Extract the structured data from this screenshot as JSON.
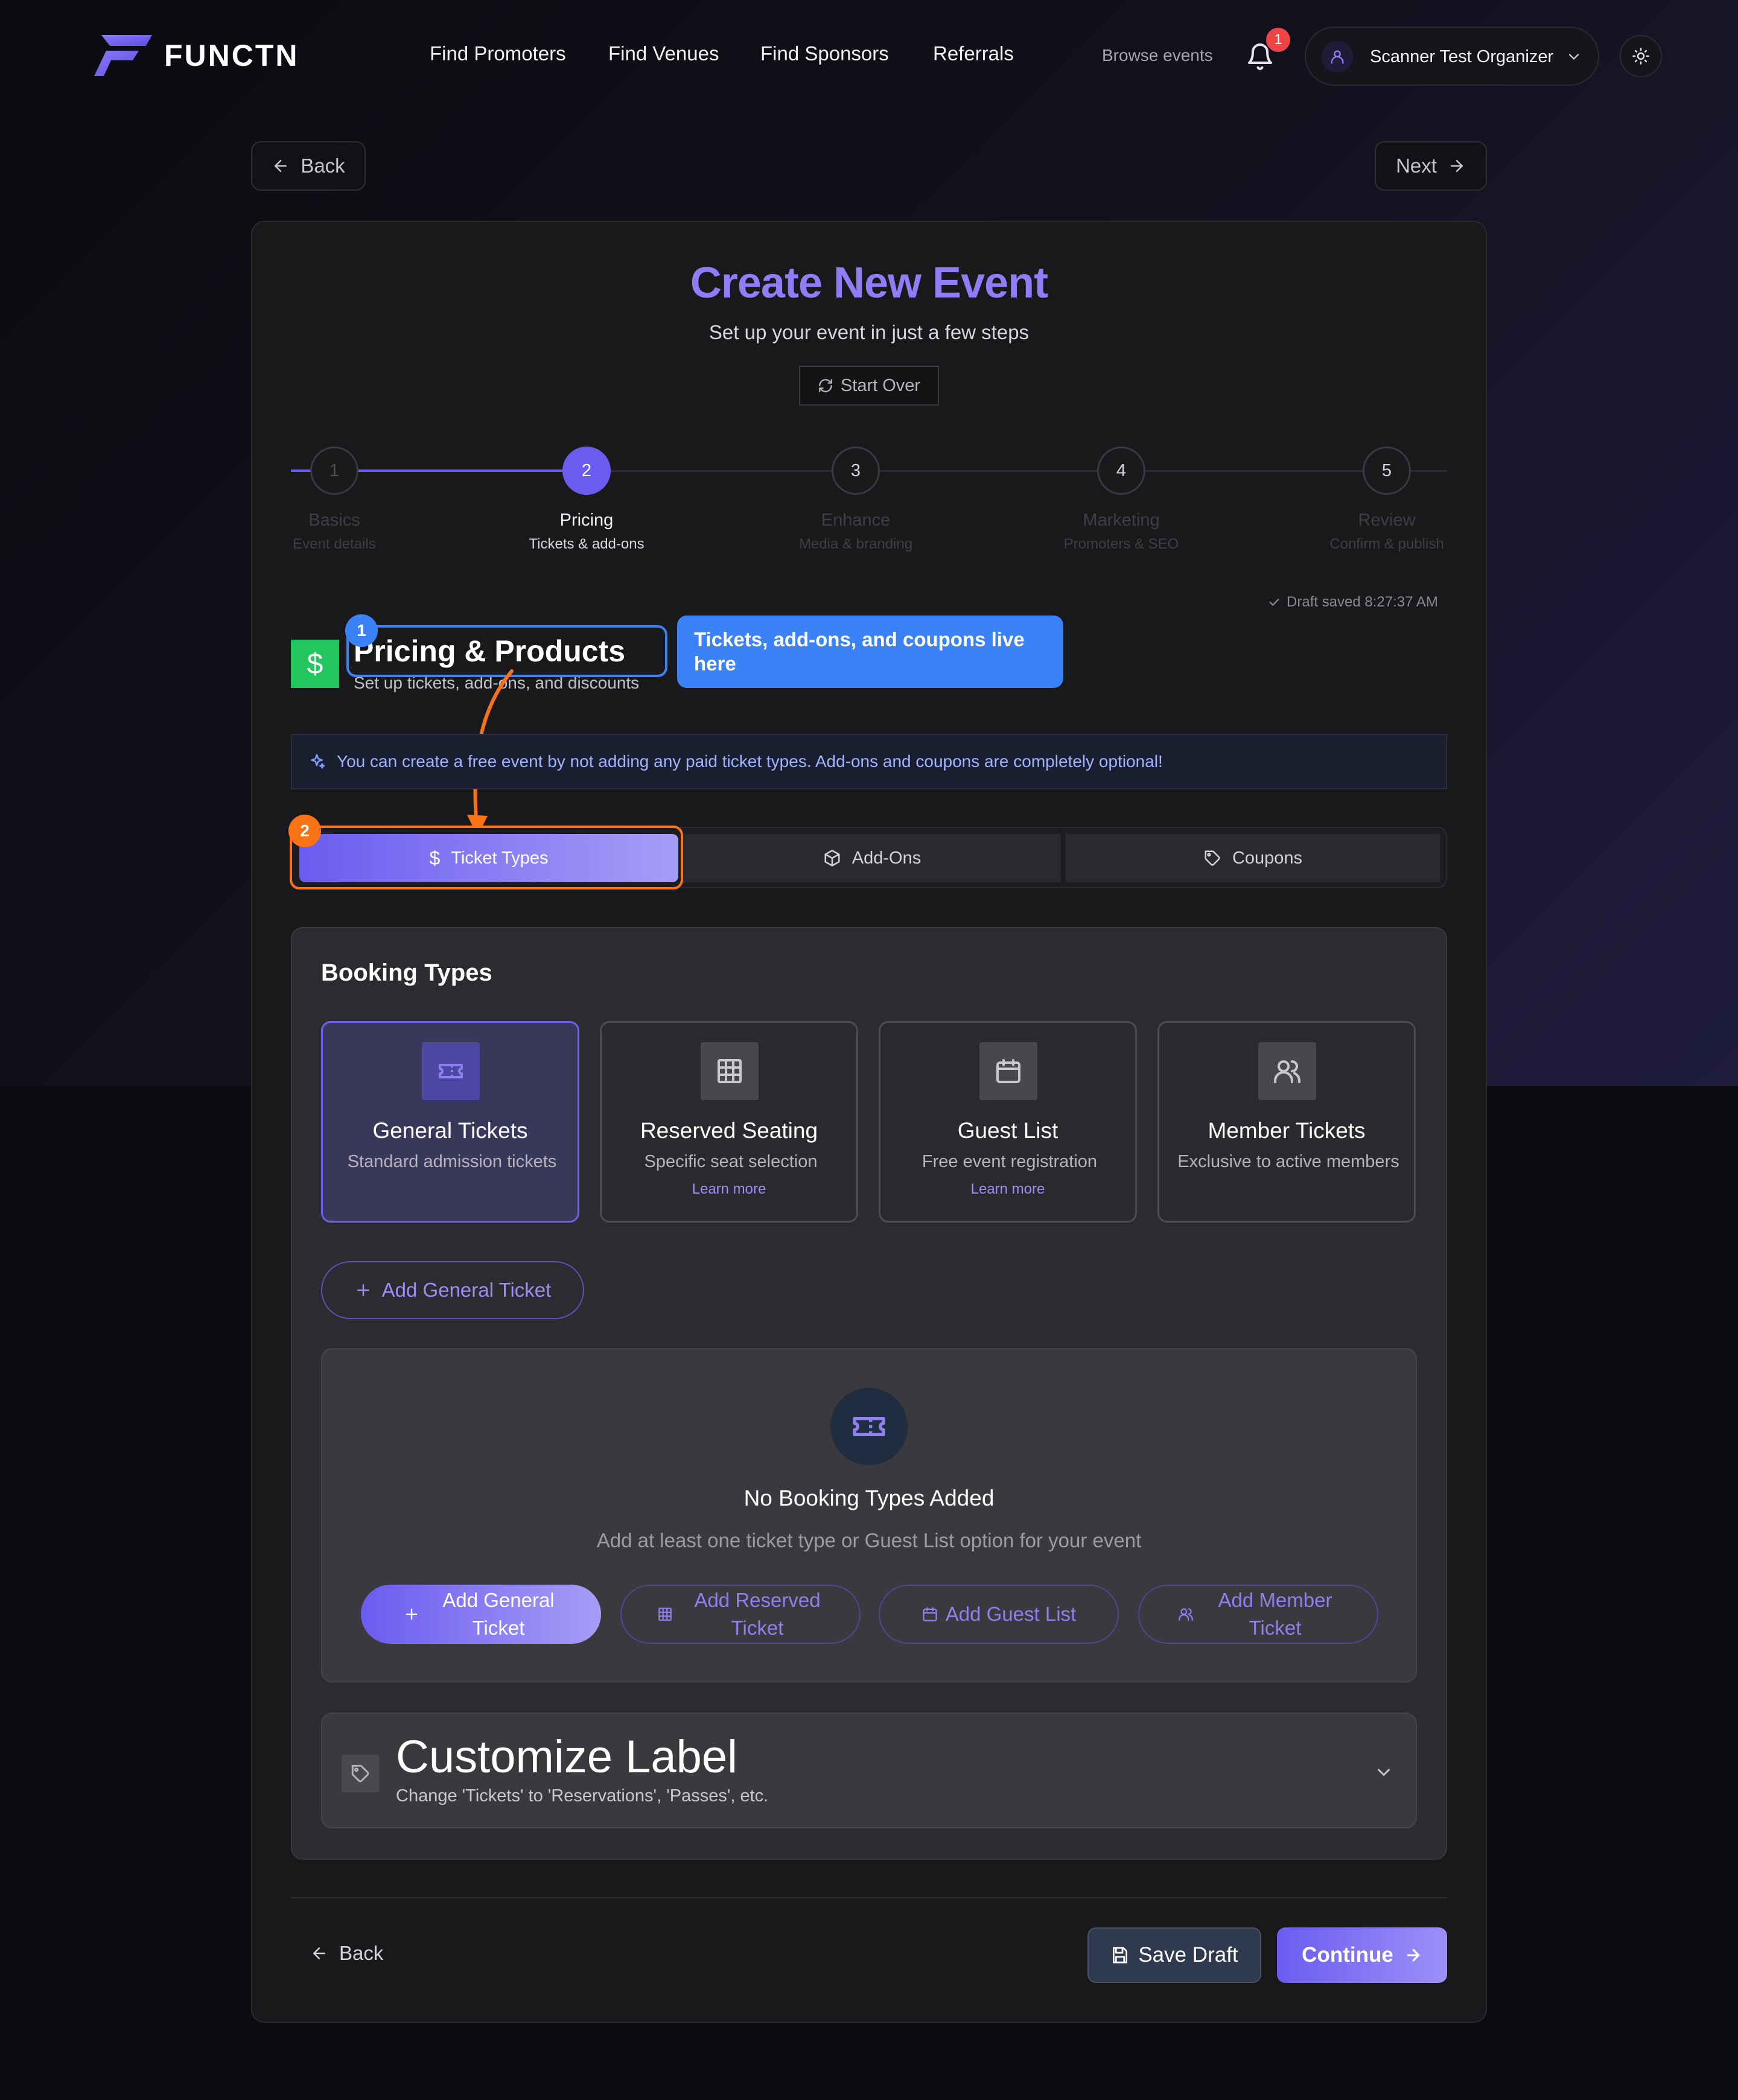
{
  "header": {
    "logo_text": "FUNCTN",
    "nav": [
      "Find Promoters",
      "Find Venues",
      "Find Sponsors",
      "Referrals"
    ],
    "browse_events": "Browse events",
    "notification_count": "1",
    "user_name": "Scanner Test Organizer"
  },
  "top_buttons": {
    "back": "Back",
    "next": "Next"
  },
  "page": {
    "title": "Create New Event",
    "subtitle": "Set up your event in just a few steps",
    "start_over": "Start Over"
  },
  "steps": [
    {
      "num": "1",
      "label": "Basics",
      "sub": "Event details",
      "state": "complete"
    },
    {
      "num": "2",
      "label": "Pricing",
      "sub": "Tickets & add-ons",
      "state": "active"
    },
    {
      "num": "3",
      "label": "Enhance",
      "sub": "Media & branding",
      "state": "upcoming"
    },
    {
      "num": "4",
      "label": "Marketing",
      "sub": "Promoters & SEO",
      "state": "upcoming"
    },
    {
      "num": "5",
      "label": "Review",
      "sub": "Confirm & publish",
      "state": "upcoming"
    }
  ],
  "draft_status": "Draft saved 8:27:37 AM",
  "section": {
    "icon_symbol": "$",
    "title": "Pricing & Products",
    "subtitle": "Set up tickets, add-ons, and discounts"
  },
  "tutorial": {
    "badge_1": "1",
    "badge_2": "2",
    "tooltip": "Tickets, add-ons, and coupons live here"
  },
  "info_message": "You can create a free event by not adding any paid ticket types. Add-ons and coupons are completely optional!",
  "tabs": [
    {
      "label": "Ticket Types",
      "icon": "dollar-icon",
      "active": true
    },
    {
      "label": "Add-Ons",
      "icon": "package-icon",
      "active": false
    },
    {
      "label": "Coupons",
      "icon": "tag-icon",
      "active": false
    }
  ],
  "booking": {
    "title": "Booking Types",
    "types": [
      {
        "title": "General Tickets",
        "desc": "Standard admission tickets",
        "link": "",
        "icon": "ticket-icon",
        "selected": true
      },
      {
        "title": "Reserved Seating",
        "desc": "Specific seat selection",
        "link": "Learn more",
        "icon": "grid-icon",
        "selected": false
      },
      {
        "title": "Guest List",
        "desc": "Free event registration",
        "link": "Learn more",
        "icon": "calendar-icon",
        "selected": false
      },
      {
        "title": "Member Tickets",
        "desc": "Exclusive to active members",
        "link": "",
        "icon": "users-icon",
        "selected": false
      }
    ],
    "add_button": "Add General Ticket",
    "empty_title": "No Booking Types Added",
    "empty_desc": "Add at least one ticket type or Guest List option for your event",
    "empty_actions": [
      {
        "label": "Add General Ticket",
        "icon": "plus-icon"
      },
      {
        "label": "Add Reserved Ticket",
        "icon": "grid-icon"
      },
      {
        "label": "Add Guest List",
        "icon": "calendar-icon"
      },
      {
        "label": "Add Member Ticket",
        "icon": "users-icon"
      }
    ]
  },
  "customize": {
    "title": "Customize Label",
    "subtitle": "Change 'Tickets' to 'Reservations', 'Passes', etc."
  },
  "footer": {
    "back": "Back",
    "save_draft": "Save Draft",
    "continue": "Continue"
  },
  "colors": {
    "accent": "#6b5cf0",
    "accent_light": "#a79cf6",
    "tutorial_blue": "#3b82f6",
    "tutorial_orange": "#f97316",
    "success_green": "#22c55e",
    "notification_red": "#ef4444"
  }
}
